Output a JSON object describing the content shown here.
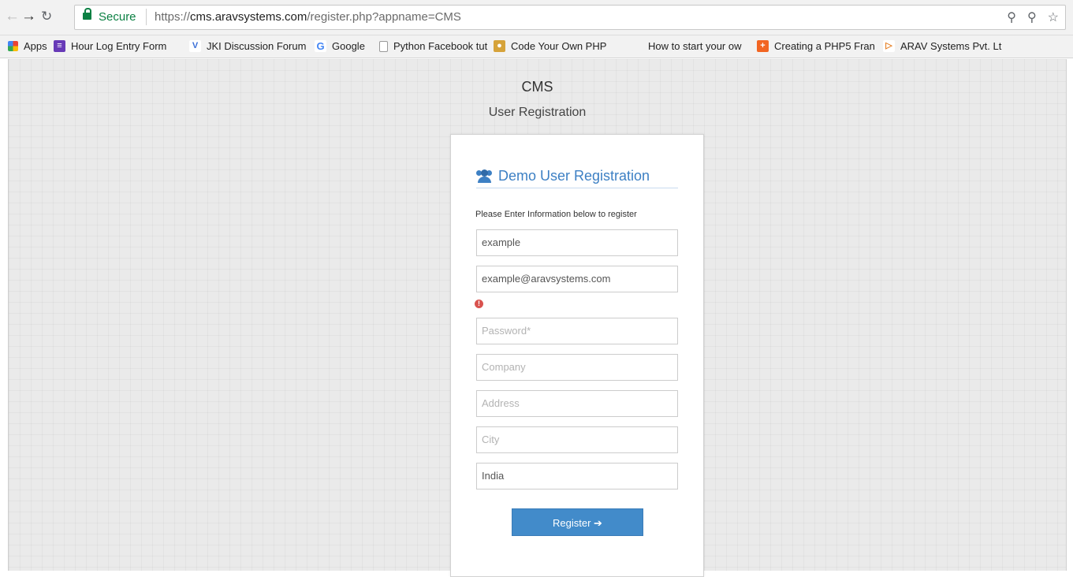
{
  "browser": {
    "secure_label": "Secure",
    "url_scheme": "https://",
    "url_host": "cms.aravsystems.com",
    "url_path": "/register.php?appname=CMS",
    "icons": [
      "back-icon",
      "forward-icon",
      "reload-icon",
      "lock-icon",
      "zoom-icon",
      "key-icon",
      "star-icon"
    ]
  },
  "bookmarks": [
    {
      "label": "Apps",
      "icon": "apps-grid-icon"
    },
    {
      "label": "Hour Log Entry Form",
      "icon": "form-icon"
    },
    {
      "label": "JKI Discussion Forum",
      "icon": "jki-icon"
    },
    {
      "label": "Google",
      "icon": "google-icon"
    },
    {
      "label": "Python Facebook tut",
      "icon": "page-icon"
    },
    {
      "label": "Code Your Own PHP",
      "icon": "php-icon"
    },
    {
      "label": "How to start your ow",
      "icon": "blank-icon"
    },
    {
      "label": "Creating a PHP5 Fran",
      "icon": "orange-plus-icon"
    },
    {
      "label": "ARAV Systems Pvt. Lt",
      "icon": "arav-icon"
    }
  ],
  "page": {
    "app_title": "CMS",
    "app_subtitle": "User Registration"
  },
  "form": {
    "heading": "Demo User Registration",
    "heading_icon": "users-icon",
    "hint": "Please Enter Information below to register",
    "username_value": "example",
    "email_value": "example@aravsystems.com",
    "error_icon": "exclamation-circle-icon",
    "password_placeholder": "Password*",
    "company_placeholder": "Company",
    "address_placeholder": "Address",
    "city_placeholder": "City",
    "country_value": "India",
    "register_label": "Register ➔"
  },
  "colors": {
    "accent": "#428bca",
    "heading": "#3d80c4",
    "secure": "#0b8043",
    "error": "#d9534f"
  }
}
